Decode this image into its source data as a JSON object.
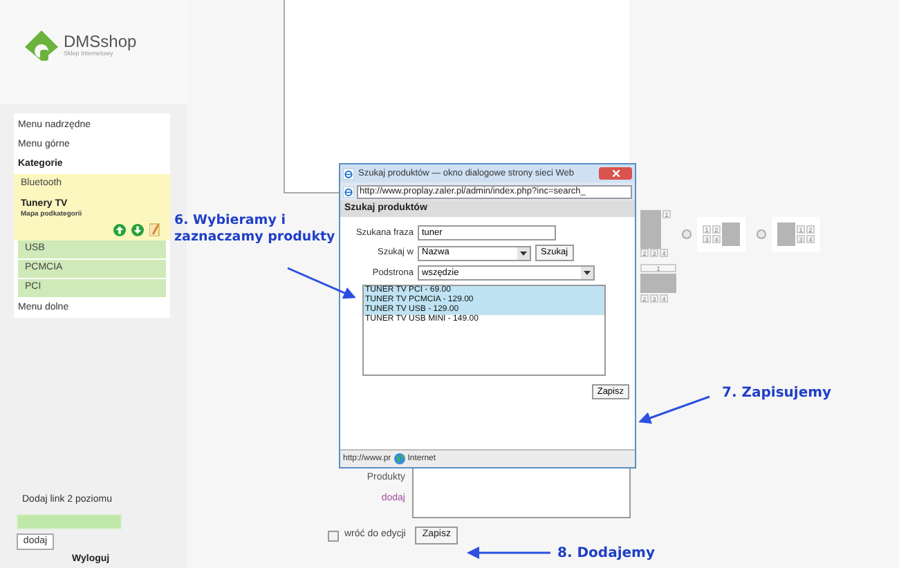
{
  "logo": {
    "name": "DMSshop",
    "tagline": "Sklep Internetowy"
  },
  "menu": {
    "items": [
      {
        "kind": "link",
        "label": "Menu nadrzędne"
      },
      {
        "kind": "link",
        "label": "Menu górne"
      },
      {
        "kind": "header",
        "label": "Kategorie"
      },
      {
        "kind": "category",
        "label": "Bluetooth"
      },
      {
        "kind": "category_open",
        "label": "Tunery TV",
        "sublabel": "Mapa podkategorii"
      },
      {
        "kind": "subcategory",
        "label": "USB"
      },
      {
        "kind": "subcategory",
        "label": "PCMCIA"
      },
      {
        "kind": "subcategory",
        "label": "PCI"
      },
      {
        "kind": "link",
        "label": "Menu dolne"
      }
    ]
  },
  "add_link": {
    "label": "Dodaj link 2 poziomu",
    "button": "dodaj"
  },
  "logout": "Wyloguj",
  "layouts": [
    {
      "kind": "top_right",
      "cells": [
        "1",
        "2",
        "3",
        "4"
      ]
    },
    {
      "kind": "grid_left",
      "selected": false,
      "cells": [
        "1",
        "2",
        "3",
        "4"
      ]
    },
    {
      "kind": "grid_right",
      "selected": false,
      "cells": [
        "1",
        "2",
        "3",
        "4"
      ]
    },
    {
      "kind": "top_bar",
      "cells": [
        "1",
        "2",
        "3",
        "4"
      ]
    }
  ],
  "form": {
    "field_label": "Produkty",
    "add_link": "dodaj",
    "back_checkbox": {
      "label": "wróć do edycji",
      "checked": false
    },
    "submit": "Zapisz"
  },
  "dialog": {
    "title": "Szukaj produktów — okno dialogowe strony sieci Web",
    "url": "http://www.proplay.zaler.pl/admin/index.php?inc=search_",
    "header": "Szukaj produktów",
    "phrase": {
      "label": "Szukana fraza",
      "value": "tuner"
    },
    "search_in": {
      "label": "Szukaj w",
      "value": "Nazwa",
      "button": "Szukaj"
    },
    "subpage": {
      "label": "Podstrona",
      "value": "wszędzie"
    },
    "results": [
      {
        "label": "TUNER TV PCI - 69.00",
        "selected": true
      },
      {
        "label": "TUNER TV PCMCIA - 129.00",
        "selected": true
      },
      {
        "label": "TUNER TV USB - 129.00",
        "selected": true
      },
      {
        "label": "TUNER TV USB MINI - 149.00",
        "selected": false
      }
    ],
    "save": "Zapisz",
    "status_url": "http://www.pr",
    "status_zone": "Internet"
  },
  "annotations": [
    {
      "text": "6. Wybieramy i zaznaczamy produkty"
    },
    {
      "text": "7. Zapisujemy"
    },
    {
      "text": "8. Dodajemy"
    }
  ]
}
